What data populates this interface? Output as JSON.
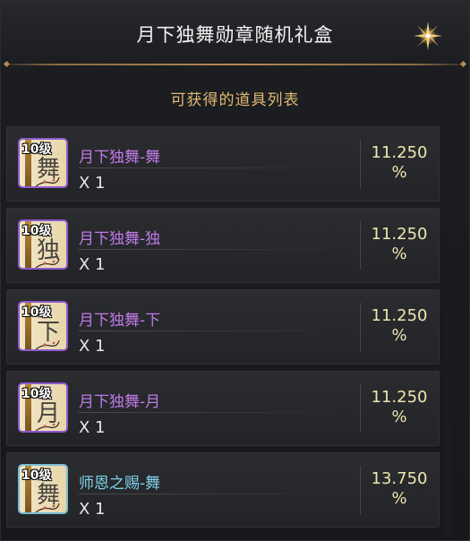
{
  "window": {
    "title": "月下独舞勋章随机礼盒",
    "close_icon": "close-star-icon"
  },
  "list": {
    "heading": "可获得的道具列表",
    "items": [
      {
        "level": "10级",
        "icon_char": "舞",
        "name": "月下独舞-舞",
        "quantity": "X 1",
        "chance": "11.250",
        "percent": "%",
        "rarity_color": "#8f5ad0"
      },
      {
        "level": "10级",
        "icon_char": "独",
        "name": "月下独舞-独",
        "quantity": "X 1",
        "chance": "11.250",
        "percent": "%",
        "rarity_color": "#8f5ad0"
      },
      {
        "level": "10级",
        "icon_char": "下",
        "name": "月下独舞-下",
        "quantity": "X 1",
        "chance": "11.250",
        "percent": "%",
        "rarity_color": "#8f5ad0"
      },
      {
        "level": "10级",
        "icon_char": "月",
        "name": "月下独舞-月",
        "quantity": "X 1",
        "chance": "11.250",
        "percent": "%",
        "rarity_color": "#8f5ad0"
      },
      {
        "level": "10级",
        "icon_char": "舞",
        "name": "师恩之赐-舞",
        "quantity": "X 1",
        "chance": "13.750",
        "percent": "%",
        "rarity_color": "#79bcd3"
      }
    ]
  }
}
